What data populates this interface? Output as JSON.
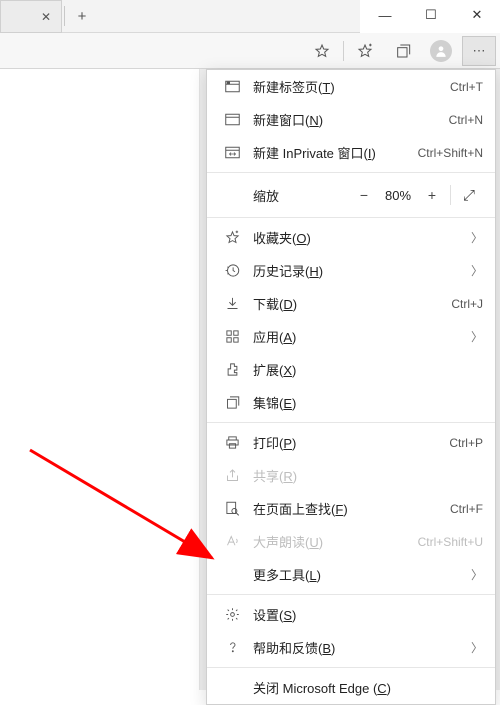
{
  "window": {
    "min": "—",
    "max": "☐",
    "close": "✕"
  },
  "tabs": {
    "close_x": "✕",
    "new_tab_plus": "+"
  },
  "toolbar": {
    "star": "☆",
    "favstar": "✩",
    "collections": "⧉",
    "more": "⋯"
  },
  "menu": {
    "new_tab": {
      "label": "新建标签页",
      "accel": "T",
      "shortcut": "Ctrl+T"
    },
    "new_window": {
      "label": "新建窗口",
      "accel": "N",
      "shortcut": "Ctrl+N"
    },
    "new_inprivate": {
      "label": "新建 InPrivate 窗口",
      "accel": "I",
      "shortcut": "Ctrl+Shift+N"
    },
    "zoom": {
      "label": "缩放",
      "value": "80%",
      "minus": "−",
      "plus": "+",
      "full": "⤢"
    },
    "favorites": {
      "label": "收藏夹",
      "accel": "O"
    },
    "history": {
      "label": "历史记录",
      "accel": "H"
    },
    "downloads": {
      "label": "下载",
      "accel": "D",
      "shortcut": "Ctrl+J"
    },
    "apps": {
      "label": "应用",
      "accel": "A"
    },
    "extensions": {
      "label": "扩展",
      "accel": "X"
    },
    "collections": {
      "label": "集锦",
      "accel": "E"
    },
    "print": {
      "label": "打印",
      "accel": "P",
      "shortcut": "Ctrl+P"
    },
    "share": {
      "label": "共享",
      "accel": "R"
    },
    "find": {
      "label": "在页面上查找",
      "accel": "F",
      "shortcut": "Ctrl+F"
    },
    "read_aloud": {
      "label": "大声朗读",
      "accel": "U",
      "shortcut": "Ctrl+Shift+U"
    },
    "more_tools": {
      "label": "更多工具",
      "accel": "L"
    },
    "settings": {
      "label": "设置",
      "accel": "S"
    },
    "help": {
      "label": "帮助和反馈",
      "accel": "B"
    },
    "close_edge": {
      "label": "关闭 Microsoft Edge ",
      "accel": "C"
    }
  }
}
